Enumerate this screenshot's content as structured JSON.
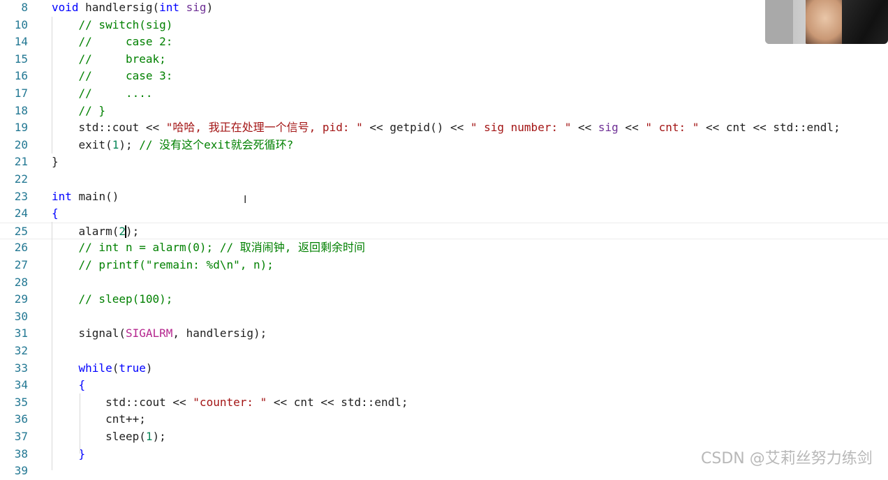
{
  "editor": {
    "lines": [
      {
        "n": "8",
        "tokens": [
          {
            "c": "kw",
            "t": "void"
          },
          {
            "c": "",
            "t": " handlersig("
          },
          {
            "c": "kw",
            "t": "int"
          },
          {
            "c": "par",
            "t": " sig"
          },
          {
            "c": "",
            "t": ")"
          }
        ]
      },
      {
        "n": "10",
        "tokens": [
          {
            "c": "",
            "t": "    "
          },
          {
            "c": "cm",
            "t": "// switch(sig)"
          }
        ]
      },
      {
        "n": "14",
        "tokens": [
          {
            "c": "",
            "t": "    "
          },
          {
            "c": "cm",
            "t": "//     case 2:"
          }
        ]
      },
      {
        "n": "15",
        "tokens": [
          {
            "c": "",
            "t": "    "
          },
          {
            "c": "cm",
            "t": "//     break;"
          }
        ]
      },
      {
        "n": "16",
        "tokens": [
          {
            "c": "",
            "t": "    "
          },
          {
            "c": "cm",
            "t": "//     case 3:"
          }
        ]
      },
      {
        "n": "17",
        "tokens": [
          {
            "c": "",
            "t": "    "
          },
          {
            "c": "cm",
            "t": "//     ...."
          }
        ]
      },
      {
        "n": "18",
        "tokens": [
          {
            "c": "",
            "t": "    "
          },
          {
            "c": "cm",
            "t": "// }"
          }
        ]
      },
      {
        "n": "19",
        "tokens": [
          {
            "c": "",
            "t": "    std::cout << "
          },
          {
            "c": "st",
            "t": "\"哈哈, 我正在处理一个信号, pid: \""
          },
          {
            "c": "",
            "t": " << getpid() << "
          },
          {
            "c": "st",
            "t": "\" sig number: \""
          },
          {
            "c": "",
            "t": " << "
          },
          {
            "c": "par",
            "t": "sig"
          },
          {
            "c": "",
            "t": " << "
          },
          {
            "c": "st",
            "t": "\" cnt: \""
          },
          {
            "c": "",
            "t": " << cnt << std::endl;"
          }
        ]
      },
      {
        "n": "20",
        "tokens": [
          {
            "c": "",
            "t": "    exit("
          },
          {
            "c": "num",
            "t": "1"
          },
          {
            "c": "",
            "t": "); "
          },
          {
            "c": "cm",
            "t": "// 没有这个exit就会死循环?"
          }
        ]
      },
      {
        "n": "21",
        "tokens": [
          {
            "c": "",
            "t": "}"
          }
        ]
      },
      {
        "n": "22",
        "tokens": []
      },
      {
        "n": "23",
        "tokens": [
          {
            "c": "kw",
            "t": "int"
          },
          {
            "c": "",
            "t": " main()"
          }
        ]
      },
      {
        "n": "24",
        "tokens": [
          {
            "c": "kw",
            "t": "{"
          }
        ]
      },
      {
        "n": "25",
        "tokens": [
          {
            "c": "",
            "t": "    alarm("
          },
          {
            "c": "num",
            "t": "2"
          },
          {
            "c": "caret",
            "t": ""
          },
          {
            "c": "",
            "t": ");"
          }
        ],
        "current": true
      },
      {
        "n": "26",
        "tokens": [
          {
            "c": "",
            "t": "    "
          },
          {
            "c": "cm",
            "t": "// int n = alarm(0); // 取消闹钟, 返回剩余时间"
          }
        ]
      },
      {
        "n": "27",
        "tokens": [
          {
            "c": "",
            "t": "    "
          },
          {
            "c": "cm",
            "t": "// printf(\"remain: %d\\n\", n);"
          }
        ]
      },
      {
        "n": "28",
        "tokens": []
      },
      {
        "n": "29",
        "tokens": [
          {
            "c": "",
            "t": "    "
          },
          {
            "c": "cm",
            "t": "// sleep(100);"
          }
        ]
      },
      {
        "n": "30",
        "tokens": []
      },
      {
        "n": "31",
        "tokens": [
          {
            "c": "",
            "t": "    signal("
          },
          {
            "c": "mac",
            "t": "SIGALRM"
          },
          {
            "c": "",
            "t": ", handlersig);"
          }
        ]
      },
      {
        "n": "32",
        "tokens": []
      },
      {
        "n": "33",
        "tokens": [
          {
            "c": "",
            "t": "    "
          },
          {
            "c": "kw",
            "t": "while"
          },
          {
            "c": "",
            "t": "("
          },
          {
            "c": "kw",
            "t": "true"
          },
          {
            "c": "",
            "t": ")"
          }
        ]
      },
      {
        "n": "34",
        "tokens": [
          {
            "c": "",
            "t": "    "
          },
          {
            "c": "kw",
            "t": "{"
          }
        ]
      },
      {
        "n": "35",
        "tokens": [
          {
            "c": "",
            "t": "        std::cout << "
          },
          {
            "c": "st",
            "t": "\"counter: \""
          },
          {
            "c": "",
            "t": " << cnt << std::endl;"
          }
        ]
      },
      {
        "n": "36",
        "tokens": [
          {
            "c": "",
            "t": "        cnt++;"
          }
        ]
      },
      {
        "n": "37",
        "tokens": [
          {
            "c": "",
            "t": "        sleep("
          },
          {
            "c": "num",
            "t": "1"
          },
          {
            "c": "",
            "t": ");"
          }
        ]
      },
      {
        "n": "38",
        "tokens": [
          {
            "c": "",
            "t": "    "
          },
          {
            "c": "kw",
            "t": "}"
          }
        ]
      },
      {
        "n": "39",
        "tokens": []
      }
    ]
  },
  "watermark": "CSDN @艾莉丝努力练剑",
  "colors": {
    "keyword": "#0000ff",
    "comment": "#008000",
    "string": "#a31515",
    "number": "#098658",
    "line_number": "#237893"
  },
  "icons": {
    "cursor": "i-beam-cursor-icon",
    "webcam": "webcam-overlay"
  }
}
